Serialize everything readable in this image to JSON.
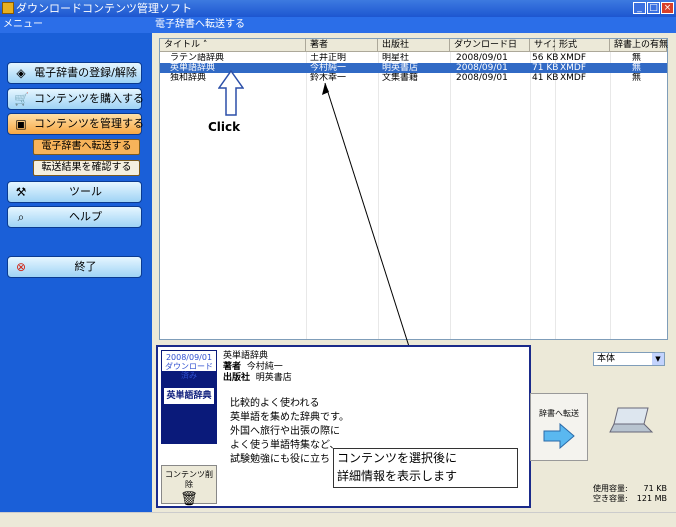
{
  "window": {
    "title": "ダウンロードコンテンツ管理ソフト"
  },
  "sidebar": {
    "header": "メニュー",
    "buttons": [
      {
        "label": "電子辞書の登録/解除",
        "icon": "dictionary-icon"
      },
      {
        "label": "コンテンツを購入する",
        "icon": "cart-icon"
      },
      {
        "label": "コンテンツを管理する",
        "icon": "manage-icon"
      },
      {
        "label": "ツール",
        "icon": "tools-icon"
      },
      {
        "label": "ヘルプ",
        "icon": "magnifier-icon"
      },
      {
        "label": "終了",
        "icon": "exit-icon"
      }
    ],
    "subitems": [
      {
        "label": "電子辞書へ転送する"
      },
      {
        "label": "転送結果を確認する"
      }
    ]
  },
  "main": {
    "header": "電子辞書へ転送する",
    "columns": [
      "タイトル",
      "著者",
      "出版社",
      "ダウンロード日",
      "サイズ",
      "形式",
      "辞書上の有無"
    ],
    "rows": [
      {
        "title": "ラテン語辞典",
        "author": "土井正明",
        "publisher": "明星社",
        "date": "2008/09/01",
        "size": "56 KB",
        "format": "XMDF",
        "exists": "無"
      },
      {
        "title": "英単語辞典",
        "author": "今村純一",
        "publisher": "明英書店",
        "date": "2008/09/01",
        "size": "71 KB",
        "format": "XMDF",
        "exists": "無"
      },
      {
        "title": "独和辞典",
        "author": "鈴木幸一",
        "publisher": "文集書籍",
        "date": "2008/09/01",
        "size": "41 KB",
        "format": "XMDF",
        "exists": "無"
      }
    ]
  },
  "annotation": {
    "click": "Click",
    "callout_line1": "コンテンツを選択後に",
    "callout_line2": "詳細情報を表示します"
  },
  "detail": {
    "thumb_date": "2008/09/01",
    "thumb_status": "ダウンロード済み",
    "thumb_title": "英単語辞典",
    "delete_label": "コンテンツ削除",
    "title": "英単語辞典",
    "author_label": "著者",
    "author": "今村純一",
    "publisher_label": "出版社",
    "publisher": "明英書店",
    "desc": [
      "比較的よく使われる",
      "英単語を集めた辞典です。",
      "外国へ旅行や出張の際に",
      "よく使う単語特集など、",
      "試験勉強にも役に立ち"
    ]
  },
  "right": {
    "device_select": "本体",
    "send_label": "辞書へ転送",
    "used_label": "使用容量:",
    "used_value": "71 KB",
    "free_label": "空き容量:",
    "free_value": "121 MB"
  },
  "colors": {
    "sidebar": "#1a5fd8",
    "accent_orange": "#f7a845",
    "selection": "#316ac5"
  }
}
